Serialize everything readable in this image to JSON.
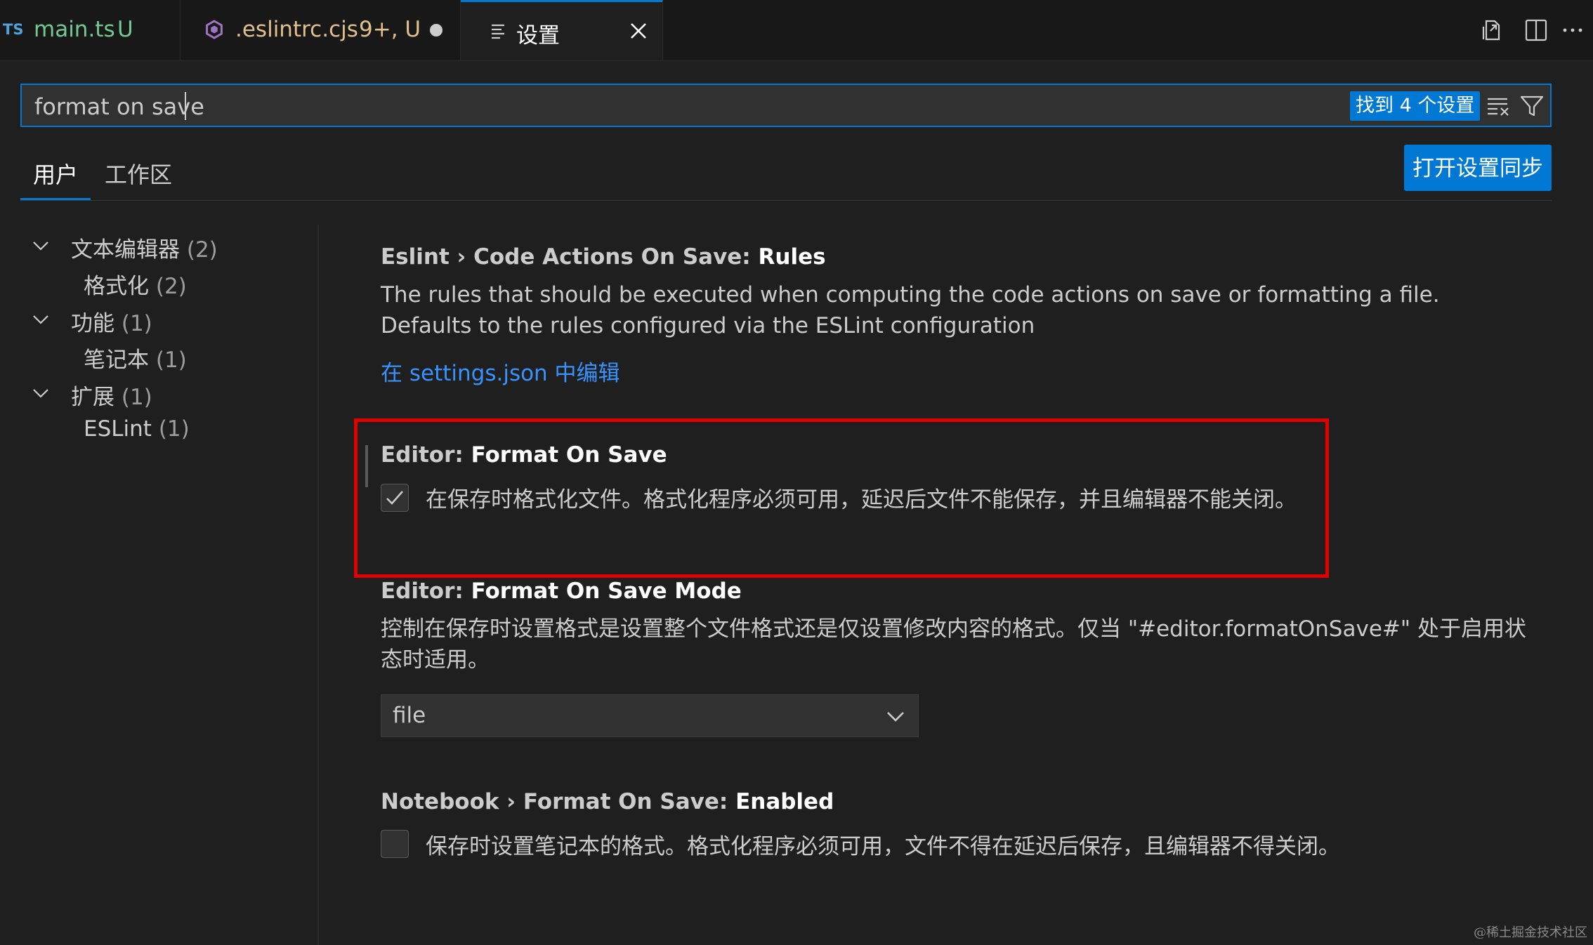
{
  "tabs": {
    "main": {
      "lang_badge": "TS",
      "name": "main.ts",
      "status": "U"
    },
    "eslint": {
      "name": ".eslintrc.cjs",
      "status": "9+, U"
    },
    "settings": {
      "name": "设置"
    }
  },
  "search": {
    "value": "format on save",
    "found_badge": "找到 4 个设置"
  },
  "scopes": {
    "user": "用户",
    "workspace": "工作区",
    "sync_button": "打开设置同步"
  },
  "toc": [
    {
      "label": "文本编辑器",
      "count": "(2)",
      "expanded": true,
      "level": 0
    },
    {
      "label": "格式化",
      "count": "(2)",
      "level": 1
    },
    {
      "label": "功能",
      "count": "(1)",
      "expanded": true,
      "level": 0
    },
    {
      "label": "笔记本",
      "count": "(1)",
      "level": 1
    },
    {
      "label": "扩展",
      "count": "(1)",
      "expanded": true,
      "level": 0
    },
    {
      "label": "ESLint",
      "count": "(1)",
      "level": 1
    }
  ],
  "settings": {
    "eslint_rules": {
      "category": "Eslint › Code Actions On Save: ",
      "name": "Rules",
      "description": "The rules that should be executed when computing the code actions on save or formatting a file. Defaults to the rules configured via the ESLint configuration",
      "edit_link": "在 settings.json 中编辑"
    },
    "format_on_save": {
      "category": "Editor: ",
      "name": "Format On Save",
      "checked": true,
      "description": "在保存时格式化文件。格式化程序必须可用，延迟后文件不能保存，并且编辑器不能关闭。"
    },
    "format_on_save_mode": {
      "category": "Editor: ",
      "name": "Format On Save Mode",
      "description": "控制在保存时设置格式是设置整个文件格式还是仅设置修改内容的格式。仅当 \"#editor.formatOnSave#\" 处于启用状态时适用。",
      "value": "file"
    },
    "notebook_format_on_save": {
      "category": "Notebook › Format On Save: ",
      "name": "Enabled",
      "checked": false,
      "description": "保存时设置笔记本的格式。格式化程序必须可用，文件不得在延迟后保存，且编辑器不得关闭。"
    }
  },
  "watermark": "@稀土掘金技术社区",
  "colors": {
    "accent": "#0078d4",
    "highlight": "#e00000",
    "link": "#3794ff",
    "git_untracked": "#73c991",
    "git_modified": "#e2c08d"
  }
}
